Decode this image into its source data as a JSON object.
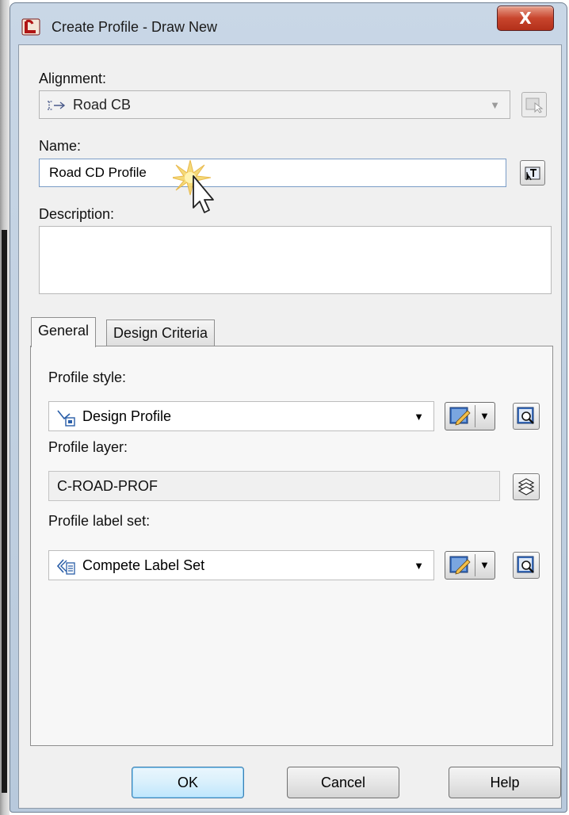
{
  "window": {
    "title": "Create Profile - Draw New",
    "close_label": "X"
  },
  "alignment": {
    "label": "Alignment:",
    "value": "Road CB"
  },
  "name": {
    "label": "Name:",
    "value": "Road CD Profile"
  },
  "description": {
    "label": "Description:",
    "value": ""
  },
  "tabs": [
    {
      "label": "General",
      "active": true
    },
    {
      "label": "Design Criteria",
      "active": false
    }
  ],
  "general": {
    "profile_style_label": "Profile style:",
    "profile_style_value": "Design Profile",
    "profile_layer_label": "Profile layer:",
    "profile_layer_value": "C-ROAD-PROF",
    "label_set_label": "Profile label set:",
    "label_set_value": "Compete Label Set"
  },
  "buttons": {
    "ok": "OK",
    "cancel": "Cancel",
    "help": "Help"
  },
  "colors": {
    "title_gradient": "#c9d7e6",
    "close_red": "#c8452d",
    "client_bg": "#f0f0f0",
    "default_button": "#bee6fd"
  },
  "icons": {
    "app": "civil3d-app-icon",
    "alignment": "alignment-icon",
    "pick_alignment": "pick-from-drawing-icon",
    "name_template": "name-template-icon",
    "profile_style": "profile-style-icon",
    "edit": "edit-style-icon",
    "preview": "preview-magnifier-icon",
    "layer": "layer-stack-icon",
    "label_set": "label-set-icon",
    "cursor": "mouse-pointer-icon"
  }
}
